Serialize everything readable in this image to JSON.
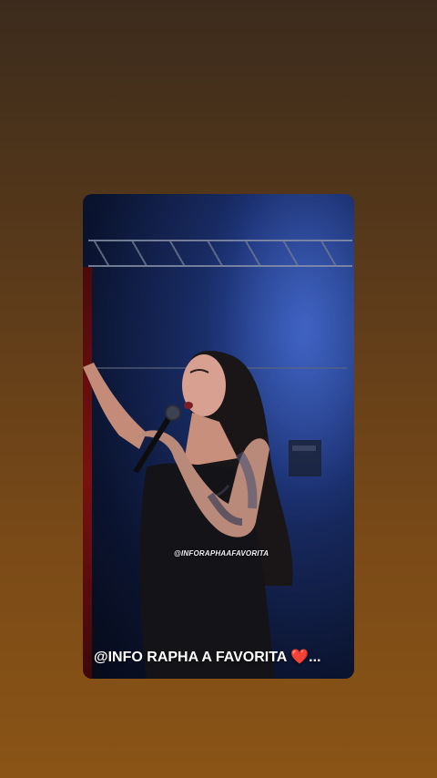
{
  "story": {
    "watermark": "@INFORAPHAAFAVORITA",
    "caption_text": "@INFO RAPHA A FAVORITA",
    "caption_emoji": "❤️",
    "caption_ellipsis": "..."
  },
  "colors": {
    "background_top": "#3c2b1c",
    "background_bottom": "#8a5416",
    "stage_blue": "#2d4b9a",
    "heart": "#e1283a"
  }
}
